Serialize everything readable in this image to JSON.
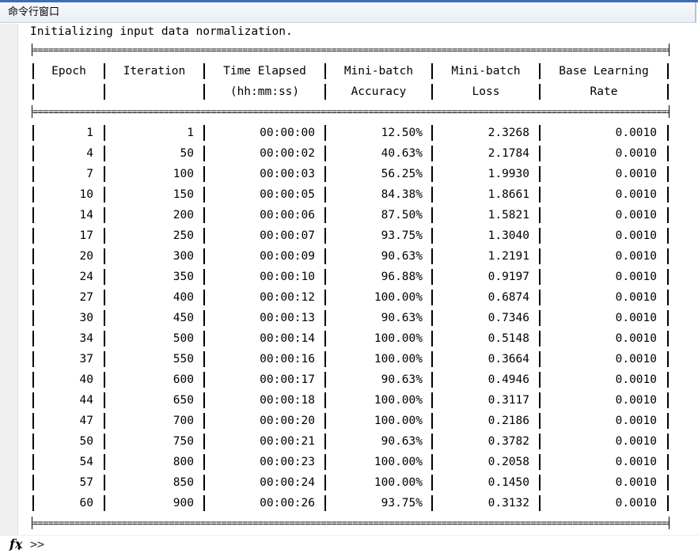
{
  "window": {
    "title": "命令行窗口"
  },
  "output": {
    "message": "Initializing input data normalization.",
    "rule_text": "=========================================================================================================================================================================================================================================================",
    "headers": {
      "row1": [
        "Epoch",
        "Iteration",
        "Time Elapsed",
        "Mini-batch",
        "Mini-batch",
        "Base Learning"
      ],
      "row2": [
        "",
        "",
        "(hh:mm:ss)",
        "Accuracy",
        "Loss",
        "Rate"
      ]
    },
    "rows": [
      [
        "1",
        "1",
        "00:00:00",
        "12.50%",
        "2.3268",
        "0.0010"
      ],
      [
        "4",
        "50",
        "00:00:02",
        "40.63%",
        "2.1784",
        "0.0010"
      ],
      [
        "7",
        "100",
        "00:00:03",
        "56.25%",
        "1.9930",
        "0.0010"
      ],
      [
        "10",
        "150",
        "00:00:05",
        "84.38%",
        "1.8661",
        "0.0010"
      ],
      [
        "14",
        "200",
        "00:00:06",
        "87.50%",
        "1.5821",
        "0.0010"
      ],
      [
        "17",
        "250",
        "00:00:07",
        "93.75%",
        "1.3040",
        "0.0010"
      ],
      [
        "20",
        "300",
        "00:00:09",
        "90.63%",
        "1.2191",
        "0.0010"
      ],
      [
        "24",
        "350",
        "00:00:10",
        "96.88%",
        "0.9197",
        "0.0010"
      ],
      [
        "27",
        "400",
        "00:00:12",
        "100.00%",
        "0.6874",
        "0.0010"
      ],
      [
        "30",
        "450",
        "00:00:13",
        "90.63%",
        "0.7346",
        "0.0010"
      ],
      [
        "34",
        "500",
        "00:00:14",
        "100.00%",
        "0.5148",
        "0.0010"
      ],
      [
        "37",
        "550",
        "00:00:16",
        "100.00%",
        "0.3664",
        "0.0010"
      ],
      [
        "40",
        "600",
        "00:00:17",
        "90.63%",
        "0.4946",
        "0.0010"
      ],
      [
        "44",
        "650",
        "00:00:18",
        "100.00%",
        "0.3117",
        "0.0010"
      ],
      [
        "47",
        "700",
        "00:00:20",
        "100.00%",
        "0.2186",
        "0.0010"
      ],
      [
        "50",
        "750",
        "00:00:21",
        "90.63%",
        "0.3782",
        "0.0010"
      ],
      [
        "54",
        "800",
        "00:00:23",
        "100.00%",
        "0.2058",
        "0.0010"
      ],
      [
        "57",
        "850",
        "00:00:24",
        "100.00%",
        "0.1450",
        "0.0010"
      ],
      [
        "60",
        "900",
        "00:00:26",
        "93.75%",
        "0.3132",
        "0.0010"
      ]
    ]
  },
  "prompt_bar": {
    "fx_label": "fx",
    "prompt_symbol": ">>"
  }
}
